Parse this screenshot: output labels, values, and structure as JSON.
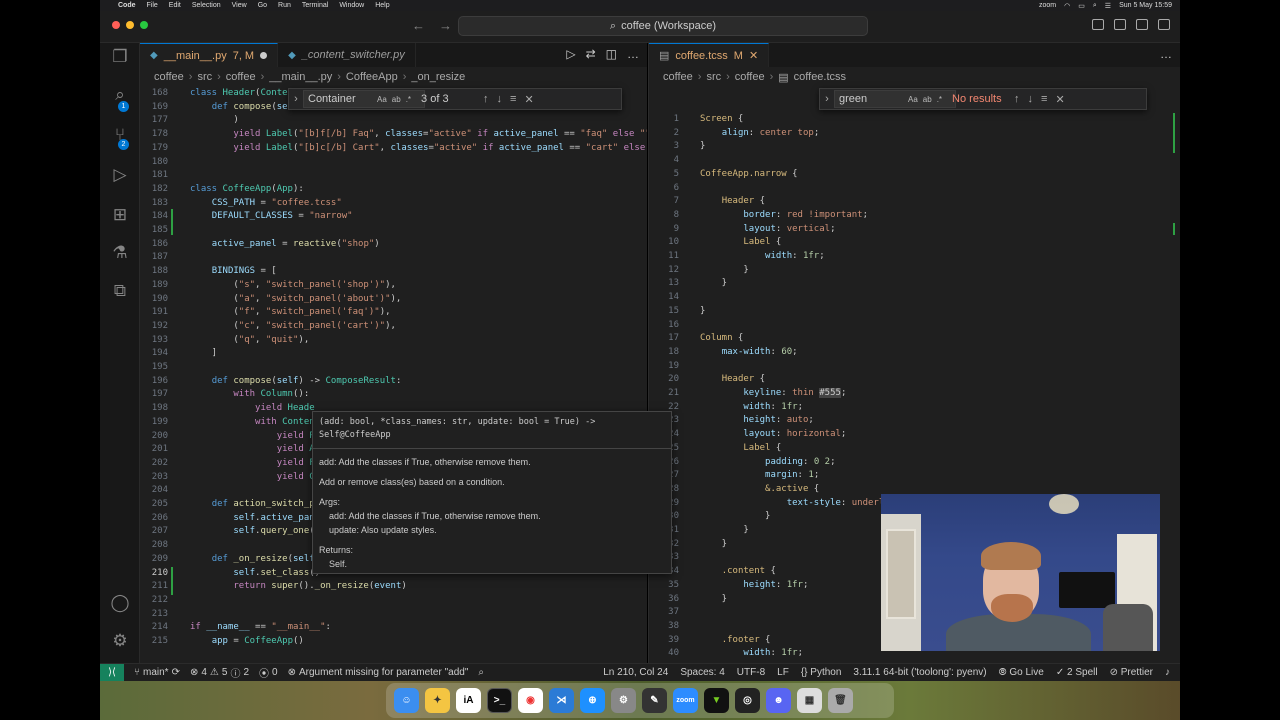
{
  "menubar": {
    "app_name": "Code",
    "items": [
      "File",
      "Edit",
      "Selection",
      "View",
      "Go",
      "Run",
      "Terminal",
      "Window",
      "Help"
    ],
    "zoom_label": "zoom",
    "datetime": "Sun 5 May 15:59"
  },
  "titlebar": {
    "search_text": "coffee (Workspace)"
  },
  "activity": {
    "scm_badge": "1",
    "debug_badge": "2"
  },
  "left_editor": {
    "tabs": [
      {
        "label": "__main__.py",
        "status": "7, M",
        "active": true
      },
      {
        "label": "_content_switcher.py",
        "active": false
      }
    ],
    "breadcrumb": [
      "coffee",
      "src",
      "coffee",
      "__main__.py",
      "CoffeeApp",
      "_on_resize"
    ],
    "find": {
      "query": "Container",
      "result": "3 of 3"
    },
    "lines": [
      {
        "n": "168",
        "html": "<span class='kw'>class</span> <span class='cls'>Header</span>(<span class='cls'>Conte</span>"
      },
      {
        "n": "169",
        "html": "    <span class='kw'>def</span> <span class='fn'>compose</span>(<span class='self'>se</span>"
      },
      {
        "n": "177",
        "html": "        )"
      },
      {
        "n": "178",
        "html": "        <span class='ctl'>yield</span> <span class='cls'>Label</span>(<span class='str'>\"[b]f[/b] Faq\"</span>, <span class='var'>classes</span>=<span class='str'>\"active\"</span> <span class='ctl'>if</span> <span class='var'>active_panel</span> == <span class='str'>\"faq\"</span> <span class='ctl'>else</span> <span class='str'>\"\"</span>)"
      },
      {
        "n": "179",
        "html": "        <span class='ctl'>yield</span> <span class='cls'>Label</span>(<span class='str'>\"[b]c[/b] Cart\"</span>, <span class='var'>classes</span>=<span class='str'>\"active\"</span> <span class='ctl'>if</span> <span class='var'>active_panel</span> == <span class='str'>\"cart\"</span> <span class='ctl'>else</span> <span class='str'>\"</span>"
      },
      {
        "n": "180",
        "html": ""
      },
      {
        "n": "181",
        "html": ""
      },
      {
        "n": "182",
        "html": "<span class='kw'>class</span> <span class='cls'>CoffeeApp</span>(<span class='cls'>App</span>):"
      },
      {
        "n": "183",
        "html": "    <span class='var'>CSS_PATH</span> = <span class='str'>\"coffee.tcss\"</span>"
      },
      {
        "n": "184",
        "html": "    <span class='var'>DEFAULT_CLASSES</span> = <span class='str'>\"narrow\"</span>"
      },
      {
        "n": "185",
        "html": ""
      },
      {
        "n": "186",
        "html": "    <span class='var'>active_panel</span> = <span class='fn'>reactive</span>(<span class='str'>\"shop\"</span>)"
      },
      {
        "n": "187",
        "html": ""
      },
      {
        "n": "188",
        "html": "    <span class='var'>BINDINGS</span> = ["
      },
      {
        "n": "189",
        "html": "        (<span class='str'>\"s\"</span>, <span class='str'>\"switch_panel('shop')\"</span>),"
      },
      {
        "n": "190",
        "html": "        (<span class='str'>\"a\"</span>, <span class='str'>\"switch_panel('about')\"</span>),"
      },
      {
        "n": "191",
        "html": "        (<span class='str'>\"f\"</span>, <span class='str'>\"switch_panel('faq')\"</span>),"
      },
      {
        "n": "192",
        "html": "        (<span class='str'>\"c\"</span>, <span class='str'>\"switch_panel('cart')\"</span>),"
      },
      {
        "n": "193",
        "html": "        (<span class='str'>\"q\"</span>, <span class='str'>\"quit\"</span>),"
      },
      {
        "n": "194",
        "html": "    ]"
      },
      {
        "n": "195",
        "html": ""
      },
      {
        "n": "196",
        "html": "    <span class='kw'>def</span> <span class='fn'>compose</span>(<span class='self'>self</span>) -> <span class='cls'>ComposeResult</span>:"
      },
      {
        "n": "197",
        "html": "        <span class='ctl'>with</span> <span class='cls'>Column</span>():"
      },
      {
        "n": "198",
        "html": "            <span class='ctl'>yield</span> <span class='cls'>Heade</span>"
      },
      {
        "n": "199",
        "html": "            <span class='ctl'>with</span> <span class='cls'>Conten</span>"
      },
      {
        "n": "200",
        "html": "                <span class='ctl'>yield</span> <span class='cls'>P</span>"
      },
      {
        "n": "201",
        "html": "                <span class='ctl'>yield</span> <span class='cls'>A</span>"
      },
      {
        "n": "202",
        "html": "                <span class='ctl'>yield</span> <span class='cls'>F</span>"
      },
      {
        "n": "203",
        "html": "                <span class='ctl'>yield</span> <span class='cls'>C</span>"
      },
      {
        "n": "204",
        "html": ""
      },
      {
        "n": "205",
        "html": "    <span class='kw'>def</span> <span class='fn'>action_switch_p</span>"
      },
      {
        "n": "206",
        "html": "        <span class='self'>self</span>.<span class='var'>active_pan</span>"
      },
      {
        "n": "207",
        "html": "        <span class='self'>self</span>.<span class='fn'>query_one</span>("
      },
      {
        "n": "208",
        "html": ""
      },
      {
        "n": "209",
        "html": "    <span class='kw'>def</span> <span class='fn'>_on_resize</span>(<span class='self'>self</span>"
      },
      {
        "n": "210",
        "html": "        <span class='self'>self</span>.<span class='fn'>set_class</span>()"
      },
      {
        "n": "211",
        "html": "        <span class='ctl'>return</span> <span class='fn'>super</span>().<span class='fn'>_on_resize</span>(<span class='var'>event</span>)"
      },
      {
        "n": "212",
        "html": ""
      },
      {
        "n": "213",
        "html": ""
      },
      {
        "n": "214",
        "html": "<span class='ctl'>if</span> <span class='var'>__name__</span> == <span class='str'>\"__main__\"</span>:"
      },
      {
        "n": "215",
        "html": "    <span class='var'>app</span> = <span class='cls'>CoffeeApp</span>()"
      }
    ],
    "current_line": "210"
  },
  "hover": {
    "signature_1": "(add: bool, *class_names: str, update: bool = True) ->",
    "signature_2": "Self@CoffeeApp",
    "desc_1": "add: Add the classes if True, otherwise remove them.",
    "desc_2": "Add or remove class(es) based on a condition.",
    "args_label": "Args:",
    "arg_add": "add: Add the classes if True, otherwise remove them.",
    "arg_update": "update: Also update styles.",
    "returns_label": "Returns:",
    "returns_value": "Self."
  },
  "right_editor": {
    "tabs": [
      {
        "label": "coffee.tcss",
        "status": "M",
        "active": true
      }
    ],
    "breadcrumb": [
      "coffee",
      "src",
      "coffee",
      "coffee.tcss"
    ],
    "find": {
      "query": "green",
      "result": "No results"
    },
    "lines": [
      {
        "n": "1",
        "html": "<span class='css-sel'>Screen</span> {"
      },
      {
        "n": "2",
        "html": "    <span class='css-prop'>align</span>: <span class='css-val'>center top</span>;"
      },
      {
        "n": "3",
        "html": "}"
      },
      {
        "n": "4",
        "html": ""
      },
      {
        "n": "5",
        "html": "<span class='css-sel'>CoffeeApp.narrow</span> {"
      },
      {
        "n": "6",
        "html": ""
      },
      {
        "n": "7",
        "html": "    <span class='css-sel'>Header</span> {"
      },
      {
        "n": "8",
        "html": "        <span class='css-prop'>border</span>: <span class='css-val'>red !important</span>;"
      },
      {
        "n": "9",
        "html": "        <span class='css-prop'>layout</span>: <span class='css-val'>vertical</span>;"
      },
      {
        "n": "10",
        "html": "        <span class='css-sel'>Label</span> {"
      },
      {
        "n": "11",
        "html": "            <span class='css-prop'>width</span>: <span class='css-num'>1fr</span>;"
      },
      {
        "n": "12",
        "html": "        }"
      },
      {
        "n": "13",
        "html": "    }"
      },
      {
        "n": "14",
        "html": ""
      },
      {
        "n": "15",
        "html": "}"
      },
      {
        "n": "16",
        "html": ""
      },
      {
        "n": "17",
        "html": "<span class='css-sel'>Column</span> {"
      },
      {
        "n": "18",
        "html": "    <span class='css-prop'>max-width</span>: <span class='css-num'>60</span>;"
      },
      {
        "n": "19",
        "html": ""
      },
      {
        "n": "20",
        "html": "    <span class='css-sel'>Header</span> {"
      },
      {
        "n": "21",
        "html": "        <span class='css-prop'>keyline</span>: <span class='css-val'>thin</span> <span style='background:#444'>#555</span>;"
      },
      {
        "n": "22",
        "html": "        <span class='css-prop'>width</span>: <span class='css-num'>1fr</span>;"
      },
      {
        "n": "23",
        "html": "        <span class='css-prop'>height</span>: <span class='css-val'>auto</span>;"
      },
      {
        "n": "24",
        "html": "        <span class='css-prop'>layout</span>: <span class='css-val'>horizontal</span>;"
      },
      {
        "n": "25",
        "html": "        <span class='css-sel'>Label</span> {"
      },
      {
        "n": "26",
        "html": "            <span class='css-prop'>padding</span>: <span class='css-num'>0 2</span>;"
      },
      {
        "n": "27",
        "html": "            <span class='css-prop'>margin</span>: <span class='css-num'>1</span>;"
      },
      {
        "n": "28",
        "html": "            <span class='css-sel'>&amp;.active</span> {"
      },
      {
        "n": "29",
        "html": "                <span class='css-prop'>text-style</span>: <span class='css-val'>underl</span>"
      },
      {
        "n": "30",
        "html": "            }"
      },
      {
        "n": "31",
        "html": "        }"
      },
      {
        "n": "32",
        "html": "    }"
      },
      {
        "n": "33",
        "html": ""
      },
      {
        "n": "34",
        "html": "    <span class='css-sel'>.content</span> {"
      },
      {
        "n": "35",
        "html": "        <span class='css-prop'>height</span>: <span class='css-num'>1fr</span>;"
      },
      {
        "n": "36",
        "html": "    }"
      },
      {
        "n": "37",
        "html": ""
      },
      {
        "n": "38",
        "html": ""
      },
      {
        "n": "39",
        "html": "    <span class='css-sel'>.footer</span> {"
      },
      {
        "n": "40",
        "html": "        <span class='css-prop'>width</span>: <span class='css-num'>1fr</span>;"
      }
    ]
  },
  "statusbar": {
    "branch": "main*",
    "errors": "4",
    "warnings": "5",
    "infos": "2",
    "ports": "0",
    "problem": "Argument missing for parameter \"add\"",
    "position": "Ln 210, Col 24",
    "spaces": "Spaces: 4",
    "encoding": "UTF-8",
    "eol": "LF",
    "language": "Python",
    "interpreter": "3.11.1 64-bit ('toolong': pyenv)",
    "golive": "Go Live",
    "spell": "2 Spell",
    "prettier": "Prettier"
  },
  "dock": {
    "zoom_label": "zoom"
  },
  "colors": {
    "accent": "#0078d4",
    "status_remote": "#16825d",
    "editor_bg": "#1f1f1f"
  }
}
